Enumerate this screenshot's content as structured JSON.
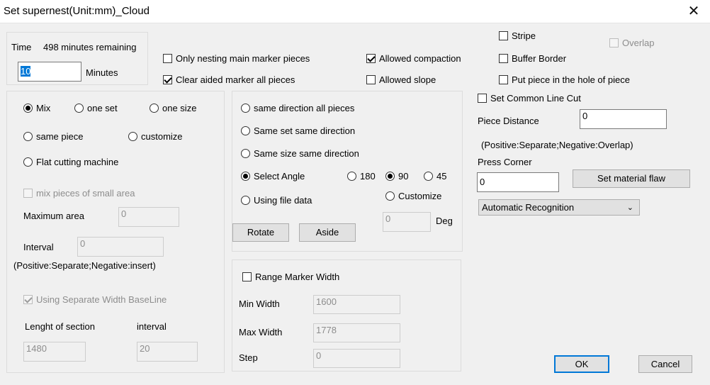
{
  "window": {
    "title": "Set supernest(Unit:mm)_Cloud",
    "close_glyph": "✕"
  },
  "time": {
    "label": "Time",
    "remaining": "498 minutes remaining",
    "value": "10",
    "unit": "Minutes"
  },
  "top_options": {
    "only_nesting": "Only nesting main marker pieces",
    "clear_aided": "Clear aided marker all pieces",
    "allowed_compaction": "Allowed compaction",
    "allowed_slope": "Allowed slope",
    "stripe": "Stripe",
    "overlap": "Overlap",
    "buffer_border": "Buffer Border",
    "put_piece_hole": "Put piece in the hole of piece"
  },
  "mix_group": {
    "mix": "Mix",
    "one_set": "one set",
    "one_size": "one size",
    "same_piece": "same piece",
    "customize": "customize",
    "flat_cutting": "Flat cutting machine",
    "mix_small_area": "mix pieces of small area",
    "max_area_label": "Maximum area",
    "max_area_value": "0",
    "interval_label": "Interval",
    "interval_value": "0",
    "interval_note": "(Positive:Separate;Negative:insert)",
    "separate_baseline": "Using Separate Width BaseLine",
    "length_section_label": "Lenght of section",
    "length_section_value": "1480",
    "interval2_label": "interval",
    "interval2_value": "20"
  },
  "direction_group": {
    "same_all": "same direction all pieces",
    "same_set": "Same set same direction",
    "same_size": "Same size same direction",
    "select_angle": "Select Angle",
    "a180": "180",
    "a90": "90",
    "a45": "45",
    "using_file": "Using file data",
    "customize": "Customize",
    "deg_value": "0",
    "deg_label": "Deg",
    "rotate": "Rotate",
    "aside": "Aside"
  },
  "range_group": {
    "range_marker": "Range Marker Width",
    "min_label": "Min Width",
    "min_value": "1600",
    "max_label": "Max Width",
    "max_value": "1778",
    "step_label": "Step",
    "step_value": "0"
  },
  "right_panel": {
    "common_line": "Set Common Line Cut",
    "piece_distance_label": "Piece Distance",
    "piece_distance_value": "0",
    "pos_neg_note": "(Positive:Separate;Negative:Overlap)",
    "press_corner_label": "Press  Corner",
    "press_corner_value": "0",
    "material_flaw": "Set material flaw",
    "recognition": "Automatic Recognition"
  },
  "footer": {
    "ok": "OK",
    "cancel": "Cancel"
  },
  "colors": {
    "accent": "#0078d7",
    "background": "#f0f0f0"
  }
}
